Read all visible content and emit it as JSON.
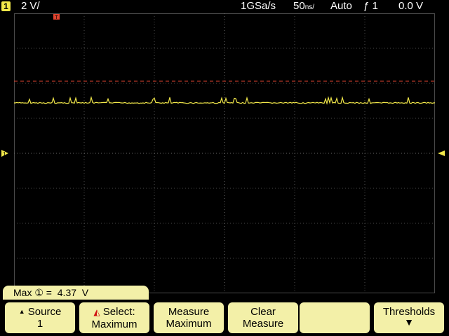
{
  "status_bar": {
    "channel_number": "1",
    "volts_per_div": "2 V/",
    "sample_rate": "1GSa/s",
    "time_per_div_value": "50",
    "time_per_div_unit": "ns/",
    "trigger_mode": "Auto",
    "trigger_source": "1",
    "trigger_level": "0.0 V"
  },
  "colors": {
    "channel1": "#f2e84a",
    "trigger_line": "#e0442f",
    "softkey_bg": "#f3f0a8",
    "grid": "#4a4a4a"
  },
  "measurement": {
    "label": "Max",
    "source_symbol": "①",
    "equals": "=",
    "value": "4.37",
    "unit": "V"
  },
  "softkeys": [
    {
      "line1": "Source",
      "line2": "1"
    },
    {
      "line1": "Select:",
      "line2": "Maximum"
    },
    {
      "line1": "Measure",
      "line2": "Maximum"
    },
    {
      "line1": "Clear",
      "line2": "Measure"
    },
    {
      "line1": "",
      "line2": ""
    },
    {
      "line1": "Thresholds",
      "line2": ""
    }
  ]
}
